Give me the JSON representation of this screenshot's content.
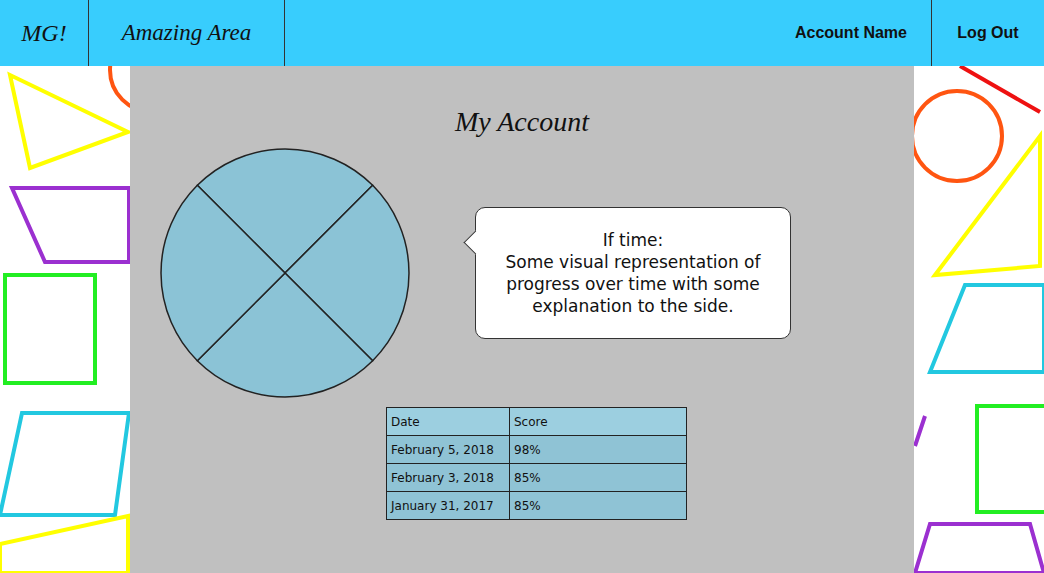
{
  "header": {
    "logo": "MG!",
    "title": "Amazing Area",
    "account": "Account Name",
    "logout": "Log Out"
  },
  "page": {
    "title": "My Account"
  },
  "progress_chart": {
    "slices": [
      25,
      25,
      25,
      25
    ]
  },
  "note": {
    "lines": [
      "If time:",
      "Some visual representation of progress over time with some explanation to the side."
    ]
  },
  "table": {
    "columns": [
      "Date",
      "Score"
    ],
    "rows": [
      [
        "February 5, 2018",
        "98%"
      ],
      [
        "February 3, 2018",
        "85%"
      ],
      [
        "January 31, 2017",
        "85%"
      ]
    ]
  }
}
